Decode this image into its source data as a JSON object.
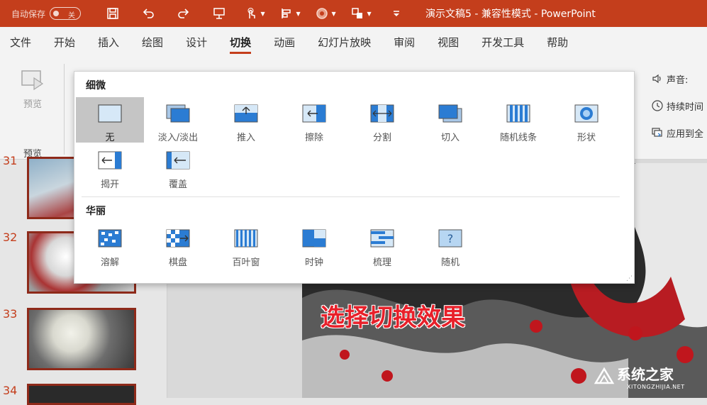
{
  "titlebar": {
    "autosave_label": "自动保存",
    "autosave_state": "关",
    "doc_title": "演示文稿5  -  兼容性模式  -  PowerPoint",
    "quick_access": [
      {
        "icon": "save-icon"
      },
      {
        "icon": "undo-icon"
      },
      {
        "icon": "redo-icon"
      },
      {
        "icon": "present-icon"
      },
      {
        "icon": "touch-mode-icon"
      },
      {
        "icon": "align-icon"
      },
      {
        "icon": "theme-icon"
      },
      {
        "icon": "arrange-icon"
      },
      {
        "icon": "customize-icon"
      }
    ]
  },
  "tabs": [
    "文件",
    "开始",
    "插入",
    "绘图",
    "设计",
    "切换",
    "动画",
    "幻灯片放映",
    "审阅",
    "视图",
    "开发工具",
    "帮助"
  ],
  "active_tab": "切换",
  "ribbon": {
    "preview_label": "预览",
    "preview_group": "预览",
    "sound_label": "声音:",
    "duration_label": "持续时间",
    "apply_all_label": "应用到全"
  },
  "gallery": {
    "subtle_title": "细微",
    "exciting_title": "华丽",
    "subtle_items": [
      "无",
      "淡入/淡出",
      "推入",
      "擦除",
      "分割",
      "切入",
      "随机线条",
      "形状",
      "揭开",
      "覆盖"
    ],
    "exciting_items": [
      "溶解",
      "棋盘",
      "百叶窗",
      "时钟",
      "梳理",
      "随机"
    ],
    "selected": "无"
  },
  "slides": {
    "numbers": [
      "31",
      "32",
      "33",
      "34"
    ]
  },
  "slide": {
    "caption": "选择切换效果"
  },
  "watermark": {
    "cn": "系统之家",
    "en": "XITONGZHIJIA.NET"
  },
  "colors": {
    "accent": "#c43e1c",
    "icon_blue": "#2b7cd3",
    "caption": "#e8202a"
  }
}
